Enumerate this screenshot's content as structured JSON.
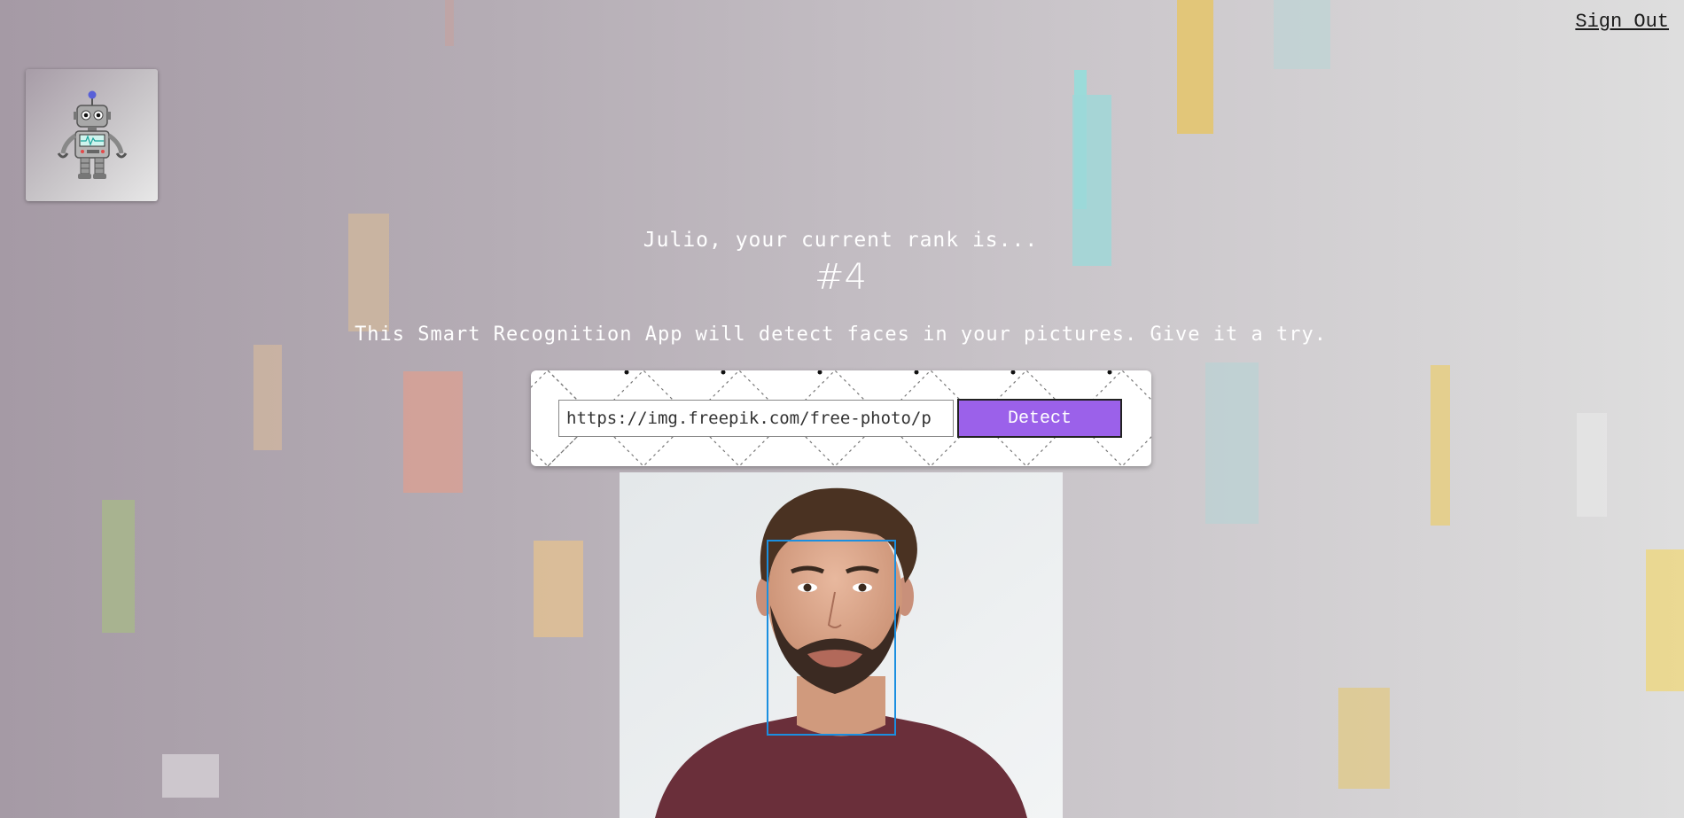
{
  "nav": {
    "sign_out": "Sign Out"
  },
  "logo": {
    "icon": "robot-icon"
  },
  "rank": {
    "message": "Julio, your current rank is...",
    "number": "#4"
  },
  "intro": {
    "text": "This Smart Recognition App will detect faces in your pictures. Give it a try."
  },
  "form": {
    "url_value": "https://img.freepik.com/free-photo/p",
    "detect_label": "Detect"
  },
  "result": {
    "image": "portrait-photo",
    "faces_detected": 1
  },
  "colors": {
    "accent": "#9b61ea",
    "face_box": "#1b8fe0"
  }
}
